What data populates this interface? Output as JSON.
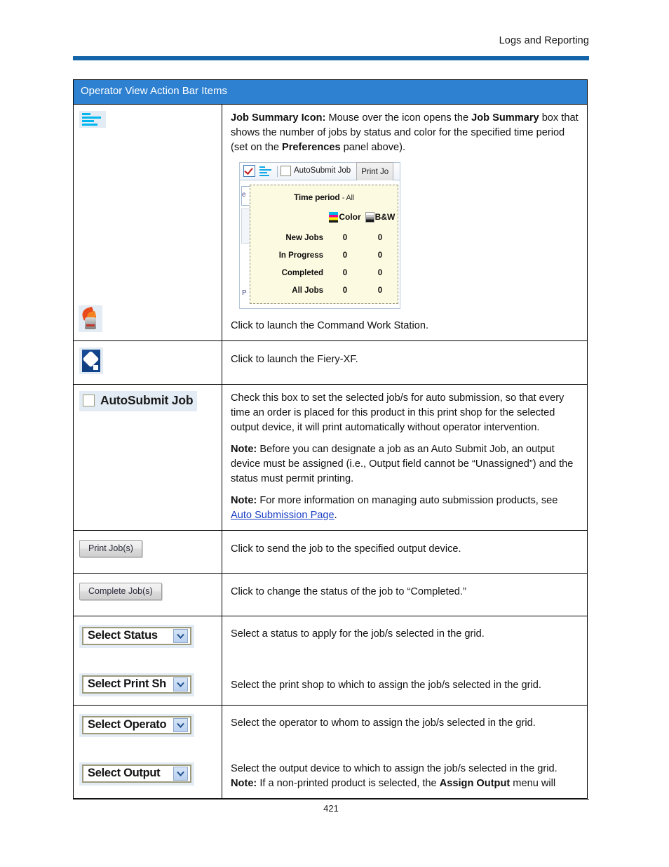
{
  "header": {
    "running_head": "Logs and Reporting",
    "rule_color": "#1364a8"
  },
  "table": {
    "caption": "Operator View Action Bar Items",
    "caption_bg": "#2e81d1",
    "rows": [
      {
        "icon_name": "job-summary-icon",
        "desc_parts": [
          {
            "bold": "Job Summary Icon:",
            "text": " Mouse over the icon opens the "
          },
          {
            "bold": "Job Summary",
            "text": " box that shows the number of jobs by status and color for the specified time period (set on the "
          },
          {
            "bold": "Preferences",
            "text": " panel above)."
          }
        ],
        "lead_bold": "Job Summary Icon:",
        "lead_text": " Mouse over the icon opens the ",
        "mid_bold": "Job Summary",
        "mid_text": " box that shows the number of jobs by status and color for the specified time period (set on the ",
        "end_bold": "Preferences",
        "end_text": " panel above)."
      },
      {
        "icon_name": "command-workstation-icon",
        "desc": "Click to launch the Command Work Station."
      },
      {
        "icon_name": "fiery-xf-icon",
        "desc": "Click to launch the Fiery-XF."
      },
      {
        "icon_name": "autosubmit-job-checkbox",
        "label": "AutoSubmit Job",
        "p1": "Check this box to set the selected job/s for auto submission, so that every time an order is placed for this product in this print shop for the selected output device, it will print automatically without operator intervention.",
        "note1_label": "Note:",
        "note1_text": " Before you can designate a job as an Auto Submit Job, an output device must be assigned (i.e., Output field cannot be “Unassigned”) and the status must permit printing.",
        "note2_label": "Note:",
        "note2_text": " For more information on managing auto submission products, see ",
        "note2_link": "Auto Submission Page",
        "note2_tail": "."
      },
      {
        "icon_name": "print-jobs-button",
        "label": "Print Job(s)",
        "desc": "Click to send the job to the specified output device."
      },
      {
        "icon_name": "complete-jobs-button",
        "label": "Complete Job(s)",
        "desc": "Click to change the status of the job to “Completed.”"
      },
      {
        "icon_name": "select-status-dropdown",
        "label": "Select Status",
        "desc": "Select a status to apply for the job/s selected in the grid."
      },
      {
        "icon_name": "select-print-shop-dropdown",
        "label": "Select Print Sh",
        "desc": "Select the print shop to which to assign the job/s selected in the grid."
      },
      {
        "icon_name": "select-operator-dropdown",
        "label": "Select Operato",
        "desc": "Select the operator to whom to assign the job/s selected in the grid."
      },
      {
        "icon_name": "select-output-dropdown",
        "label": "Select Output",
        "desc_line1": "Select the output device to which to assign the job/s selected in the grid.",
        "note_label": "Note:",
        "note_text_a": " If a non-printed product is selected, the ",
        "note_bold": "Assign Output",
        "note_text_b": " menu will"
      }
    ]
  },
  "job_summary_screenshot": {
    "toolbar": {
      "checkbox_icon": "checked-red-checkbox-icon",
      "summary_icon": "job-summary-bars-icon",
      "autosubmit_label": "AutoSubmit Job",
      "print_button_label": "Print Jo"
    },
    "ghost_text_left": "e",
    "ghost_text_bottom": "P",
    "time_period_label": "Time period",
    "time_period_value": "- All",
    "col_headers": [
      "Color",
      "B&W"
    ],
    "rows": [
      {
        "label": "New Jobs",
        "color": "0",
        "bw": "0"
      },
      {
        "label": "In Progress",
        "color": "0",
        "bw": "0"
      },
      {
        "label": "Completed",
        "color": "0",
        "bw": "0"
      },
      {
        "label": "All Jobs",
        "color": "0",
        "bw": "0"
      }
    ],
    "swatch_colors": {
      "cyan": "#00b7e8",
      "magenta": "#ec008c",
      "yellow": "#fff200",
      "black": "#1a1a1a"
    },
    "background": "#fdfae2"
  },
  "footer": {
    "page_number": "421"
  }
}
